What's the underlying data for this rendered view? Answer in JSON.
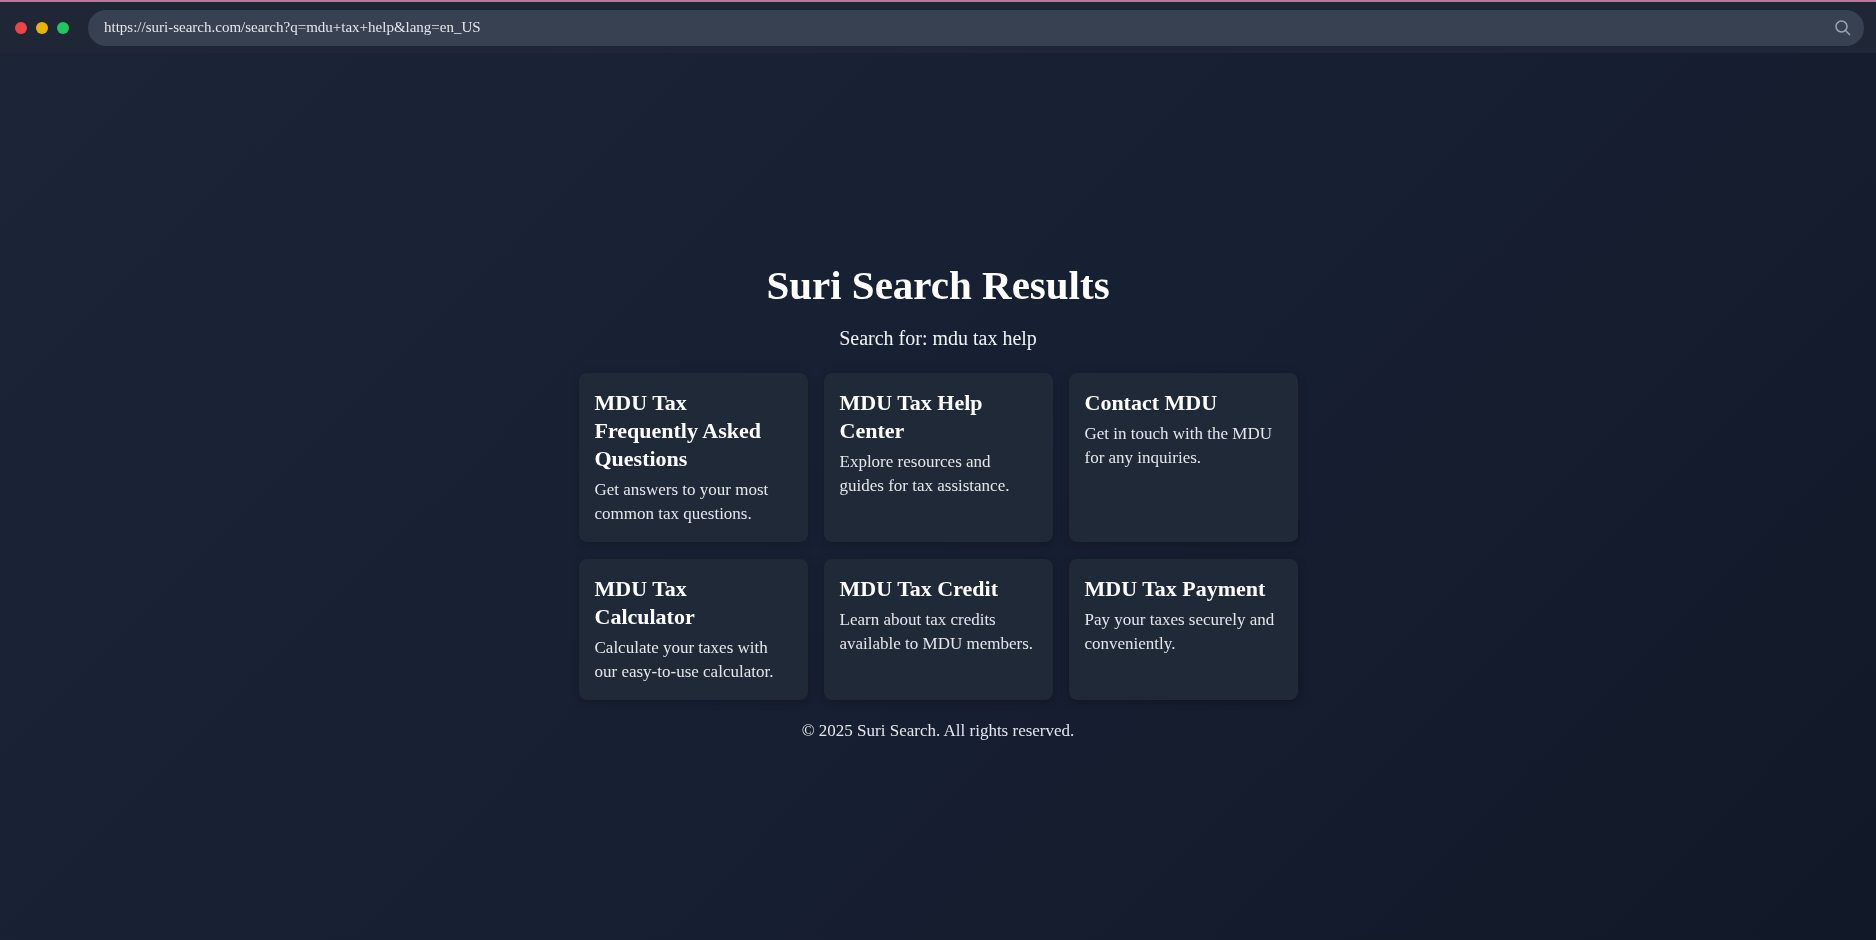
{
  "browser": {
    "url": "https://suri-search.com/search?q=mdu+tax+help&lang=en_US"
  },
  "page": {
    "title": "Suri Search Results",
    "subtitle": "Search for: mdu tax help"
  },
  "results": [
    {
      "title": "MDU Tax Frequently Asked Questions",
      "description": "Get answers to your most common tax questions."
    },
    {
      "title": "MDU Tax Help Center",
      "description": "Explore resources and guides for tax assistance."
    },
    {
      "title": "Contact MDU",
      "description": "Get in touch with the MDU for any inquiries."
    },
    {
      "title": "MDU Tax Calculator",
      "description": "Calculate your taxes with our easy-to-use calculator."
    },
    {
      "title": "MDU Tax Credit",
      "description": "Learn about tax credits available to MDU members."
    },
    {
      "title": "MDU Tax Payment",
      "description": "Pay your taxes securely and conveniently."
    }
  ],
  "footer": "© 2025 Suri Search. All rights reserved."
}
